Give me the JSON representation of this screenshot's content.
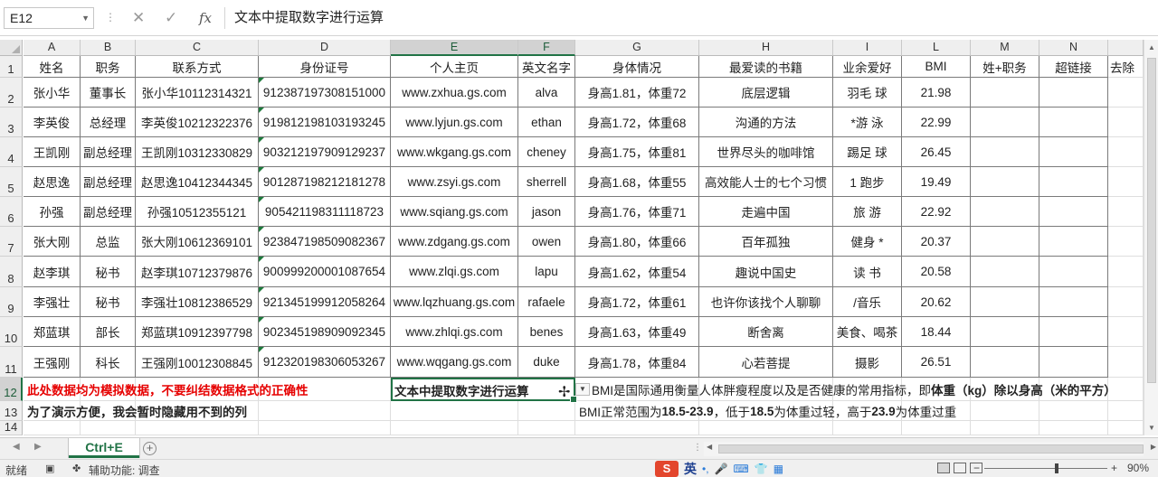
{
  "formula_bar": {
    "name_box": "E12",
    "cancel_icon": "✕",
    "enter_icon": "✓",
    "fx_icon": "fx",
    "formula": "文本中提取数字进行运算"
  },
  "columns": [
    "A",
    "B",
    "C",
    "D",
    "E",
    "F",
    "G",
    "H",
    "I",
    "L",
    "M",
    "N",
    ""
  ],
  "header_row": [
    "姓名",
    "职务",
    "联系方式",
    "身份证号",
    "个人主页",
    "英文名字",
    "身体情况",
    "最爱读的书籍",
    "业余爱好",
    "BMI",
    "姓+职务",
    "超链接",
    "去除"
  ],
  "rows": [
    [
      "张小华",
      "董事长",
      "张小华10112314321",
      "912387197308151000",
      "www.zxhua.gs.com",
      "alva",
      "身高1.81，体重72",
      "底层逻辑",
      "羽毛  球",
      "21.98",
      "",
      "",
      ""
    ],
    [
      "李英俊",
      "总经理",
      "李英俊10212322376",
      "919812198103193245",
      "www.lyjun.gs.com",
      "ethan",
      "身高1.72，体重68",
      "沟通的方法",
      "*游 泳",
      "22.99",
      "",
      "",
      ""
    ],
    [
      "王凯刚",
      "副总经理",
      "王凯刚10312330829",
      "903212197909129237",
      "www.wkgang.gs.com",
      "cheney",
      "身高1.75，体重81",
      "世界尽头的咖啡馆",
      "踢足  球",
      "26.45",
      "",
      "",
      ""
    ],
    [
      "赵思逸",
      "副总经理",
      "赵思逸10412344345",
      "901287198212181278",
      "www.zsyi.gs.com",
      "sherrell",
      "身高1.68，体重55",
      "高效能人士的七个习惯",
      "1 跑步",
      "19.49",
      "",
      "",
      ""
    ],
    [
      "孙强",
      "副总经理",
      "孙强10512355121",
      "905421198311118723",
      "www.sqiang.gs.com",
      "jason",
      "身高1.76，体重71",
      "走遍中国",
      "旅    游",
      "22.92",
      "",
      "",
      ""
    ],
    [
      "张大刚",
      "总监",
      "张大刚10612369101",
      "923847198509082367",
      "www.zdgang.gs.com",
      "owen",
      "身高1.80，体重66",
      "百年孤独",
      "健身 *",
      "20.37",
      "",
      "",
      ""
    ],
    [
      "赵李琪",
      "秘书",
      "赵李琪10712379876",
      "900999200001087654",
      "www.zlqi.gs.com",
      "lapu",
      "身高1.62，体重54",
      "趣说中国史",
      "读 书",
      "20.58",
      "",
      "",
      ""
    ],
    [
      "李强壮",
      "秘书",
      "李强壮10812386529",
      "921345199912058264",
      "www.lqzhuang.gs.com",
      "rafaele",
      "身高1.72，体重61",
      "也许你该找个人聊聊",
      "/音乐",
      "20.62",
      "",
      "",
      ""
    ],
    [
      "郑蓝琪",
      "部长",
      "郑蓝琪10912397798",
      "902345198909092345",
      "www.zhlqi.gs.com",
      "benes",
      "身高1.63，体重49",
      "断舍离",
      "美食、喝茶",
      "18.44",
      "",
      "",
      ""
    ],
    [
      "王强刚",
      "科长",
      "王强刚10012308845",
      "912320198306053267",
      "www.wqgang.gs.com",
      "duke",
      "身高1.78，体重84",
      "心若菩提",
      "摄影",
      "26.51",
      "",
      "",
      ""
    ]
  ],
  "row_numbers": [
    "1",
    "2",
    "3",
    "4",
    "5",
    "6",
    "7",
    "8",
    "9",
    "10",
    "11",
    "12",
    "13",
    "14"
  ],
  "notes": {
    "a12": "此处数据均为模拟数据，不要纠结数据格式的正确性",
    "a13": "为了演示方便，我会暂时隐藏用不到的列",
    "e12": "文本中提取数字进行运算",
    "g12_pre": "BMI是国际通用衡量人体胖瘦程度以及是否健康的常用指标，即",
    "g12_bold": "体重（kg）除以身高（米的平方）",
    "g13_a": "BMI正常范围为",
    "g13_b": "18.5-23.9",
    "g13_c": "，低于",
    "g13_d": "18.5",
    "g13_e": "为体重过轻，高于",
    "g13_f": "23.9",
    "g13_g": "为体重过重"
  },
  "sheet_tab": "Ctrl+E",
  "status": {
    "ready": "就绪",
    "accessibility": "辅助功能: 调查",
    "ime_logo": "S",
    "ime_lang": "英",
    "zoom": "90%"
  }
}
